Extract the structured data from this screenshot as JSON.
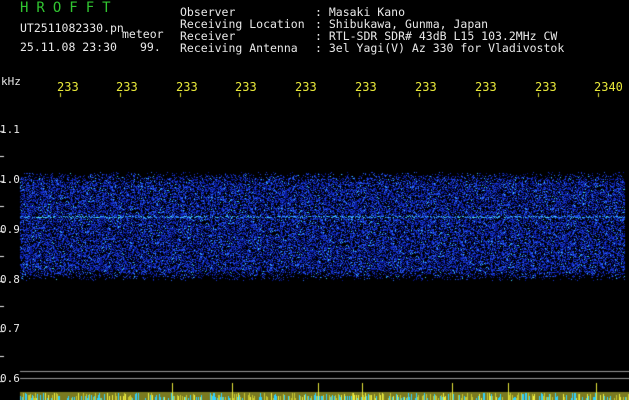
{
  "header": {
    "app_title": "HROFFT",
    "filename": "UT2511082330.pn",
    "meteor_label": "meteor",
    "datetime": "25.11.08 23:30",
    "count": "99."
  },
  "metadata": [
    {
      "label": "Observer",
      "value": ": Masaki Kano"
    },
    {
      "label": "Receiving Location",
      "value": ": Shibukawa, Gunma, Japan"
    },
    {
      "label": "Receiver",
      "value": ": RTL-SDR SDR# 43dB L15 103.2MHz CW"
    },
    {
      "label": "Receiving Antenna",
      "value": ": 3el Yagi(V) Az 330 for Vladivostok"
    }
  ],
  "axes": {
    "y_label": "kHz",
    "y_ticks": [
      "1.1",
      "1.0",
      "0.9",
      "0.8",
      "0.7",
      "0.6"
    ],
    "x_ticks": [
      "233",
      "233",
      "233",
      "233",
      "233",
      "233",
      "233",
      "233",
      "233",
      "2340"
    ]
  },
  "colors": {
    "title": "#31c631",
    "text": "#e8e8e8",
    "ticks": "#e8e83a",
    "signal_low": "#0000a0",
    "signal_high": "#40e0ff"
  },
  "band": {
    "low_khz": 0.8,
    "high_khz": 1.02,
    "carrier_khz": 0.93
  }
}
